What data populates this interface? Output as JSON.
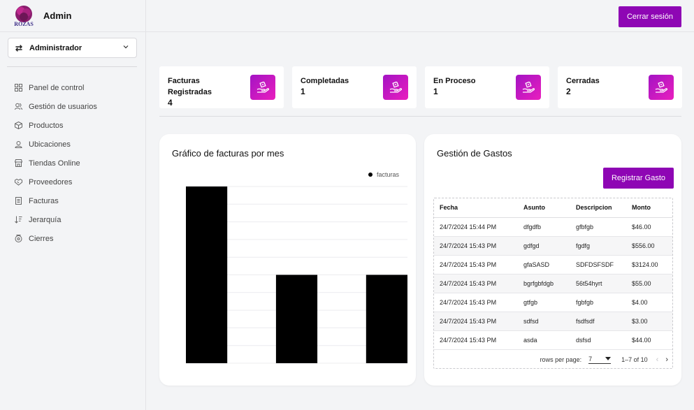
{
  "brand": {
    "name": "Admin",
    "logo_text": "ROZAS"
  },
  "role_selector": {
    "value": "Administrador"
  },
  "nav": [
    {
      "label": "Panel de control",
      "icon": "dashboard-icon"
    },
    {
      "label": "Gestión de usuarios",
      "icon": "users-icon"
    },
    {
      "label": "Productos",
      "icon": "box-icon"
    },
    {
      "label": "Ubicaciones",
      "icon": "location-icon"
    },
    {
      "label": "Tiendas Online",
      "icon": "store-icon"
    },
    {
      "label": "Proveedores",
      "icon": "handshake-icon"
    },
    {
      "label": "Facturas",
      "icon": "document-icon"
    },
    {
      "label": "Jerarquía",
      "icon": "sort-icon"
    },
    {
      "label": "Cierres",
      "icon": "lock-icon"
    }
  ],
  "header": {
    "logout_label": "Cerrar sesión"
  },
  "stats": [
    {
      "label": "Facturas Registradas",
      "value": "4"
    },
    {
      "label": "Completadas",
      "value": "1"
    },
    {
      "label": "En Proceso",
      "value": "1"
    },
    {
      "label": "Cerradas",
      "value": "2"
    }
  ],
  "chart_panel": {
    "title": "Gráfico de facturas por mes"
  },
  "chart_data": {
    "type": "bar",
    "categories": [
      "",
      "",
      ""
    ],
    "series": [
      {
        "name": "facturas",
        "values": [
          2,
          1,
          1
        ]
      }
    ],
    "ylim": [
      0,
      2
    ],
    "grid": true,
    "legend": "top-right",
    "title": "",
    "xlabel": "",
    "ylabel": ""
  },
  "expenses": {
    "title": "Gestión de Gastos",
    "register_label": "Registrar Gasto",
    "columns": [
      "Fecha",
      "Asunto",
      "Descripcion",
      "Monto"
    ],
    "rows": [
      [
        "24/7/2024 15:44 PM",
        "dfgdfb",
        "gfbfgb",
        "$46.00"
      ],
      [
        "24/7/2024 15:43 PM",
        "gdfgd",
        "fgdfg",
        "$556.00"
      ],
      [
        "24/7/2024 15:43 PM",
        "gfaSASD",
        "SDFDSFSDF",
        "$3124.00"
      ],
      [
        "24/7/2024 15:43 PM",
        "bgrfgbfdgb",
        "56t54hyrt",
        "$55.00"
      ],
      [
        "24/7/2024 15:43 PM",
        "gtfgb",
        "fgbfgb",
        "$4.00"
      ],
      [
        "24/7/2024 15:43 PM",
        "sdfsd",
        "fsdfsdf",
        "$3.00"
      ],
      [
        "24/7/2024 15:43 PM",
        "asda",
        "dsfsd",
        "$44.00"
      ]
    ],
    "pager": {
      "rows_label": "rows per page:",
      "rows_value": "7",
      "range": "1–7 of 10"
    }
  },
  "colors": {
    "accent": "#8e06b4",
    "icon_gradient_start": "#a313c4",
    "icon_gradient_end": "#ea1fbe"
  }
}
